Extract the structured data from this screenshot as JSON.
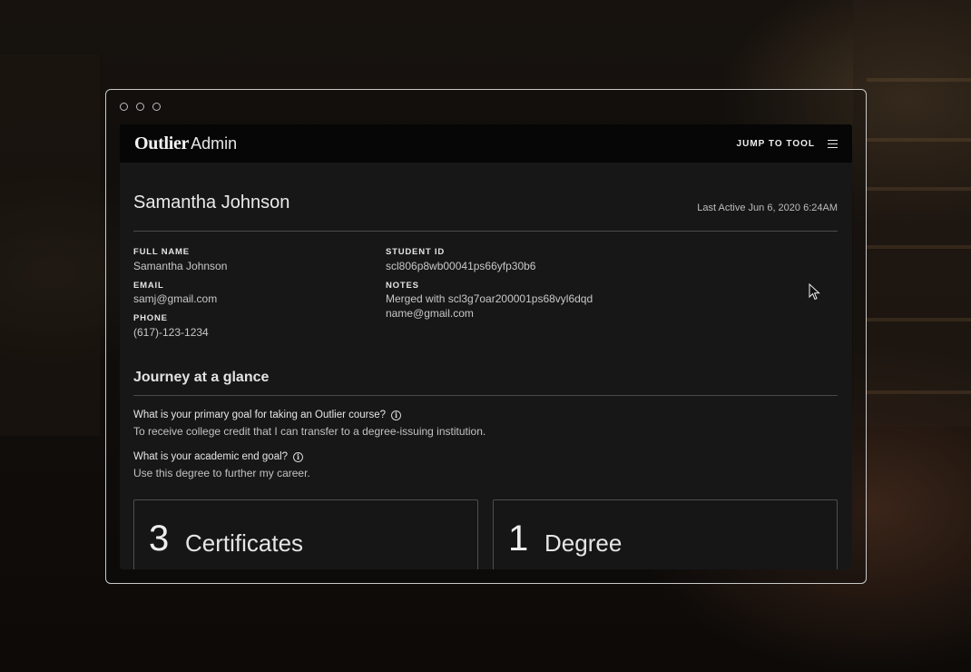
{
  "app": {
    "logo_strong": "Outlier",
    "logo_light": "Admin",
    "jump_to_tool": "JUMP TO TOOL",
    "menu_icon": "hamburger-menu-icon"
  },
  "student": {
    "name": "Samantha Johnson",
    "last_active": "Last Active Jun 6, 2020 6:24AM"
  },
  "details": {
    "full_name_label": "FULL NAME",
    "full_name": "Samantha Johnson",
    "email_label": "EMAIL",
    "email": "samj@gmail.com",
    "phone_label": "PHONE",
    "phone": "(617)-123-1234",
    "student_id_label": "STUDENT ID",
    "student_id": "scl806p8wb00041ps66yfp30b6",
    "notes_label": "NOTES",
    "notes_line1": "Merged with scl3g7oar200001ps68vyl6dqd",
    "notes_line2": "name@gmail.com"
  },
  "journey": {
    "title": "Journey at a glance",
    "q1": "What is your primary goal for taking an Outlier course?",
    "a1": "To receive college credit that I can transfer to a degree-issuing institution.",
    "q2": "What is your academic end goal?",
    "a2": "Use this degree to further my career.",
    "info_icon": "info-icon"
  },
  "stats": [
    {
      "number": "3",
      "label": "Certificates"
    },
    {
      "number": "1",
      "label": "Degree"
    }
  ],
  "colors": {
    "app_background": "#171718",
    "topbar": "#060606",
    "window_border": "#c9c9c9"
  }
}
